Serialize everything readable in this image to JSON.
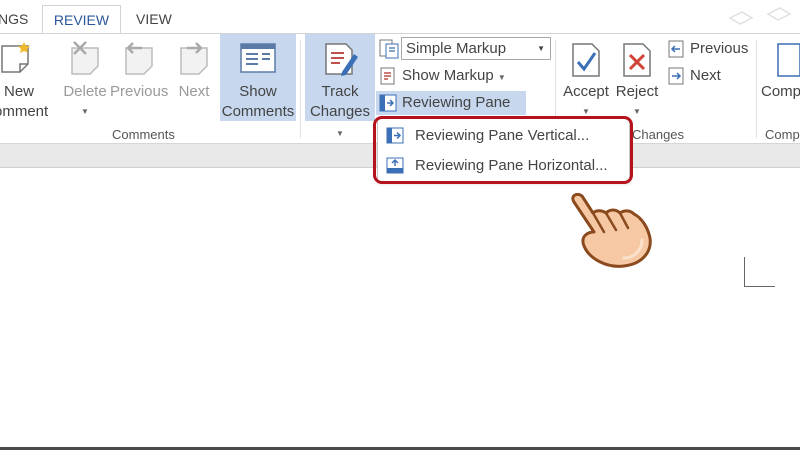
{
  "tabs": {
    "partial": "NGS",
    "review": "REVIEW",
    "view": "VIEW"
  },
  "comments_group": {
    "new_comment": {
      "line1": "New",
      "line2": "Comment",
      "shown": "omment"
    },
    "delete": "Delete",
    "previous": "Previous",
    "next": "Next",
    "show_comments": {
      "line1": "Show",
      "line2": "Comments"
    },
    "group_label": "Comments"
  },
  "tracking_group": {
    "track_changes": {
      "line1": "Track",
      "line2": "Changes"
    },
    "markup_select": {
      "value": "Simple Markup"
    },
    "show_markup": "Show Markup",
    "reviewing_pane": "Reviewing Pane"
  },
  "changes_group": {
    "accept": "Accept",
    "reject": "Reject",
    "previous": "Previous",
    "next": "Next",
    "group_label_partial": "Changes"
  },
  "compare_group": {
    "button_partial": "Comp",
    "group_label_partial": "Comp"
  },
  "reviewing_pane_menu": {
    "items": [
      {
        "label": "Reviewing Pane Vertical...",
        "icon": "pane-vertical-icon"
      },
      {
        "label": "Reviewing Pane Horizontal...",
        "icon": "pane-horizontal-icon"
      }
    ]
  },
  "colors": {
    "accent": "#2b579a",
    "selected": "#c6d7ee",
    "highlight": "#b5121b",
    "hand_fill": "#f6c9a4"
  }
}
